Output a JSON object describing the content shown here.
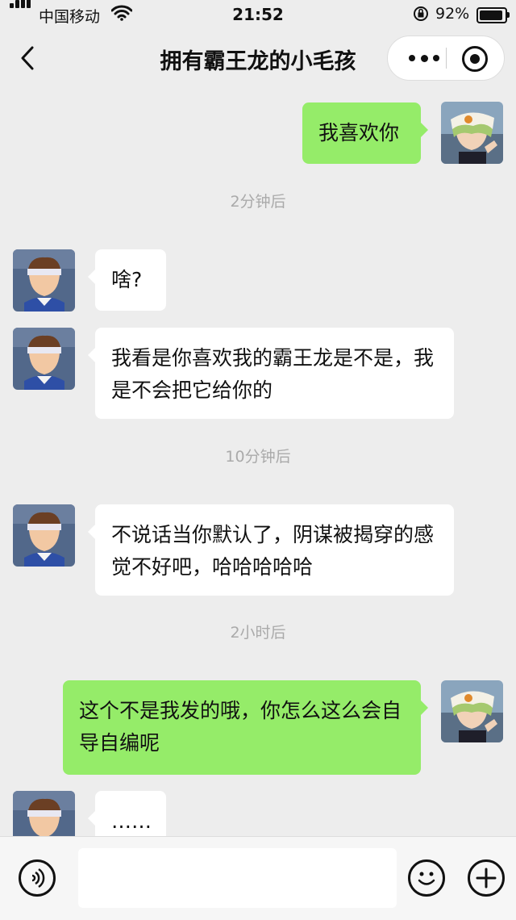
{
  "status_bar": {
    "carrier": "中国移动",
    "time": "21:52",
    "battery_percent": "92%",
    "battery_level": 0.92,
    "icons": [
      "signal-bars-icon",
      "wifi-icon",
      "orientation-lock-icon",
      "battery-icon"
    ]
  },
  "nav": {
    "title": "拥有霸王龙的小毛孩",
    "icons": [
      "back-icon",
      "more-icon",
      "close-target-icon"
    ]
  },
  "messages": [
    {
      "side": "right",
      "text": "我喜欢你"
    },
    {
      "timestamp": "2分钟后"
    },
    {
      "side": "left",
      "text": "啥?"
    },
    {
      "side": "left",
      "text": "我看是你喜欢我的霸王龙是不是，我是不会把它给你的"
    },
    {
      "timestamp": "10分钟后"
    },
    {
      "side": "left",
      "text": "不说话当你默认了，阴谋被揭穿的感觉不好吧，哈哈哈哈哈"
    },
    {
      "timestamp": "2小时后"
    },
    {
      "side": "right",
      "text": "这个不是我发的哦，你怎么这么会自导自编呢"
    },
    {
      "side": "left",
      "text": "……"
    }
  ],
  "input_bar": {
    "icons": [
      "voice-icon",
      "emoji-icon",
      "plus-icon"
    ],
    "text_value": ""
  },
  "colors": {
    "background": "#ededed",
    "outgoing_bubble": "#95ec69",
    "incoming_bubble": "#ffffff",
    "timestamp_text": "#aaaaaa"
  }
}
